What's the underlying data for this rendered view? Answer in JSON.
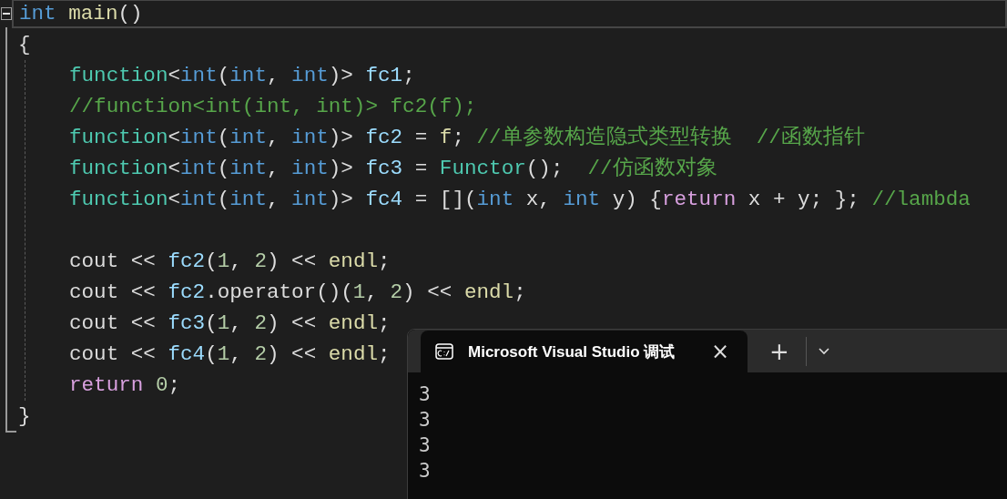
{
  "editor": {
    "lines": [
      {
        "kind": "line",
        "current": true,
        "tokens": [
          {
            "text": "int",
            "kind": "keyword"
          },
          {
            "text": " main",
            "kind": "func"
          },
          {
            "text": "()",
            "kind": "plain"
          }
        ]
      },
      {
        "kind": "line",
        "current": false,
        "tokens": [
          {
            "text": "{",
            "kind": "plain"
          }
        ]
      },
      {
        "kind": "block",
        "children": [
          {
            "kind": "line",
            "current": false,
            "tokens": [
              {
                "text": "function",
                "kind": "type"
              },
              {
                "text": "<",
                "kind": "plain"
              },
              {
                "text": "int",
                "kind": "keyword"
              },
              {
                "text": "(",
                "kind": "plain"
              },
              {
                "text": "int",
                "kind": "keyword"
              },
              {
                "text": ", ",
                "kind": "plain"
              },
              {
                "text": "int",
                "kind": "keyword"
              },
              {
                "text": ")> ",
                "kind": "plain"
              },
              {
                "text": "fc1",
                "kind": "ident"
              },
              {
                "text": ";",
                "kind": "plain"
              }
            ]
          },
          {
            "kind": "line",
            "current": false,
            "tokens": [
              {
                "text": "//function<int(int, int)> fc2(f);",
                "kind": "comment"
              }
            ]
          },
          {
            "kind": "line",
            "current": false,
            "tokens": [
              {
                "text": "function",
                "kind": "type"
              },
              {
                "text": "<",
                "kind": "plain"
              },
              {
                "text": "int",
                "kind": "keyword"
              },
              {
                "text": "(",
                "kind": "plain"
              },
              {
                "text": "int",
                "kind": "keyword"
              },
              {
                "text": ", ",
                "kind": "plain"
              },
              {
                "text": "int",
                "kind": "keyword"
              },
              {
                "text": ")> ",
                "kind": "plain"
              },
              {
                "text": "fc2",
                "kind": "ident"
              },
              {
                "text": " = ",
                "kind": "plain"
              },
              {
                "text": "f",
                "kind": "func"
              },
              {
                "text": "; ",
                "kind": "plain"
              },
              {
                "text": "//单参数构造隐式类型转换  //函数指针",
                "kind": "comment"
              }
            ]
          },
          {
            "kind": "line",
            "current": false,
            "tokens": [
              {
                "text": "function",
                "kind": "type"
              },
              {
                "text": "<",
                "kind": "plain"
              },
              {
                "text": "int",
                "kind": "keyword"
              },
              {
                "text": "(",
                "kind": "plain"
              },
              {
                "text": "int",
                "kind": "keyword"
              },
              {
                "text": ", ",
                "kind": "plain"
              },
              {
                "text": "int",
                "kind": "keyword"
              },
              {
                "text": ")> ",
                "kind": "plain"
              },
              {
                "text": "fc3",
                "kind": "ident"
              },
              {
                "text": " = ",
                "kind": "plain"
              },
              {
                "text": "Functor",
                "kind": "type"
              },
              {
                "text": "();  ",
                "kind": "plain"
              },
              {
                "text": "//仿函数对象",
                "kind": "comment"
              }
            ]
          },
          {
            "kind": "line",
            "current": false,
            "tokens": [
              {
                "text": "function",
                "kind": "type"
              },
              {
                "text": "<",
                "kind": "plain"
              },
              {
                "text": "int",
                "kind": "keyword"
              },
              {
                "text": "(",
                "kind": "plain"
              },
              {
                "text": "int",
                "kind": "keyword"
              },
              {
                "text": ", ",
                "kind": "plain"
              },
              {
                "text": "int",
                "kind": "keyword"
              },
              {
                "text": ")> ",
                "kind": "plain"
              },
              {
                "text": "fc4",
                "kind": "ident"
              },
              {
                "text": " = [](",
                "kind": "plain"
              },
              {
                "text": "int",
                "kind": "keyword"
              },
              {
                "text": " x, ",
                "kind": "plain"
              },
              {
                "text": "int",
                "kind": "keyword"
              },
              {
                "text": " y) {",
                "kind": "plain"
              },
              {
                "text": "return",
                "kind": "control"
              },
              {
                "text": " x + y; }; ",
                "kind": "plain"
              },
              {
                "text": "//lambda",
                "kind": "comment"
              }
            ]
          },
          {
            "kind": "blank"
          },
          {
            "kind": "line",
            "current": false,
            "tokens": [
              {
                "text": "cout << ",
                "kind": "plain"
              },
              {
                "text": "fc2",
                "kind": "ident"
              },
              {
                "text": "(",
                "kind": "plain"
              },
              {
                "text": "1",
                "kind": "number"
              },
              {
                "text": ", ",
                "kind": "plain"
              },
              {
                "text": "2",
                "kind": "number"
              },
              {
                "text": ") << ",
                "kind": "plain"
              },
              {
                "text": "endl",
                "kind": "func"
              },
              {
                "text": ";",
                "kind": "plain"
              }
            ]
          },
          {
            "kind": "line",
            "current": false,
            "tokens": [
              {
                "text": "cout << ",
                "kind": "plain"
              },
              {
                "text": "fc2",
                "kind": "ident"
              },
              {
                "text": ".operator()(",
                "kind": "plain"
              },
              {
                "text": "1",
                "kind": "number"
              },
              {
                "text": ", ",
                "kind": "plain"
              },
              {
                "text": "2",
                "kind": "number"
              },
              {
                "text": ") << ",
                "kind": "plain"
              },
              {
                "text": "endl",
                "kind": "func"
              },
              {
                "text": ";",
                "kind": "plain"
              }
            ]
          },
          {
            "kind": "line",
            "current": false,
            "tokens": [
              {
                "text": "cout << ",
                "kind": "plain"
              },
              {
                "text": "fc3",
                "kind": "ident"
              },
              {
                "text": "(",
                "kind": "plain"
              },
              {
                "text": "1",
                "kind": "number"
              },
              {
                "text": ", ",
                "kind": "plain"
              },
              {
                "text": "2",
                "kind": "number"
              },
              {
                "text": ") << ",
                "kind": "plain"
              },
              {
                "text": "endl",
                "kind": "func"
              },
              {
                "text": ";",
                "kind": "plain"
              }
            ]
          },
          {
            "kind": "line",
            "current": false,
            "tokens": [
              {
                "text": "cout << ",
                "kind": "plain"
              },
              {
                "text": "fc4",
                "kind": "ident"
              },
              {
                "text": "(",
                "kind": "plain"
              },
              {
                "text": "1",
                "kind": "number"
              },
              {
                "text": ", ",
                "kind": "plain"
              },
              {
                "text": "2",
                "kind": "number"
              },
              {
                "text": ") << ",
                "kind": "plain"
              },
              {
                "text": "endl",
                "kind": "func"
              },
              {
                "text": ";",
                "kind": "plain"
              }
            ]
          },
          {
            "kind": "line",
            "current": false,
            "tokens": [
              {
                "text": "return",
                "kind": "control"
              },
              {
                "text": " 0",
                "kind": "number"
              },
              {
                "text": ";",
                "kind": "plain"
              }
            ]
          }
        ]
      },
      {
        "kind": "line",
        "current": false,
        "tokens": [
          {
            "text": "}",
            "kind": "plain"
          }
        ]
      }
    ]
  },
  "terminal": {
    "tab": {
      "title": "Microsoft Visual Studio 调试",
      "close": "×"
    },
    "new_tab": "+",
    "output": [
      "3",
      "3",
      "3",
      "3"
    ]
  }
}
